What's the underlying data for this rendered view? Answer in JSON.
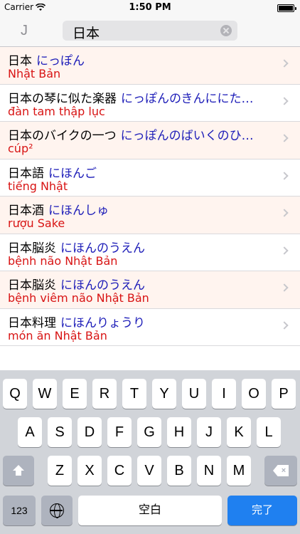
{
  "status_bar": {
    "carrier": "Carrier",
    "time": "1:50 PM"
  },
  "nav": {
    "lang_button": "J",
    "search_value": "日本"
  },
  "results": [
    {
      "term": "日本",
      "reading": "にっぽん",
      "meaning": "Nhật Bản"
    },
    {
      "term": "日本の琴に似た楽器",
      "reading": "にっぽんのきんににた…",
      "meaning": "đàn tam thập lục"
    },
    {
      "term": "日本のバイクの一つ",
      "reading": "にっぽんのばいくのひ…",
      "meaning": "cúp²"
    },
    {
      "term": "日本語",
      "reading": "にほんご",
      "meaning": "tiếng Nhật"
    },
    {
      "term": "日本酒",
      "reading": "にほんしゅ",
      "meaning": "rượu Sake"
    },
    {
      "term": "日本脳炎",
      "reading": "にほんのうえん",
      "meaning": "bệnh não Nhật Bản"
    },
    {
      "term": "日本脳炎",
      "reading": "にほんのうえん",
      "meaning": "bệnh viêm não Nhật Bản"
    },
    {
      "term": "日本料理",
      "reading": "にほんりょうり",
      "meaning": "món ăn Nhật Bản"
    }
  ],
  "keyboard": {
    "row1": [
      "Q",
      "W",
      "E",
      "R",
      "T",
      "Y",
      "U",
      "I",
      "O",
      "P"
    ],
    "row2": [
      "A",
      "S",
      "D",
      "F",
      "G",
      "H",
      "J",
      "K",
      "L"
    ],
    "row3": [
      "Z",
      "X",
      "C",
      "V",
      "B",
      "N",
      "M"
    ],
    "numbers_key": "123",
    "space_key": "空白",
    "done_key": "完了",
    "globe_icon": "globe-icon",
    "shift_icon": "shift-icon",
    "delete_icon": "delete-icon"
  }
}
